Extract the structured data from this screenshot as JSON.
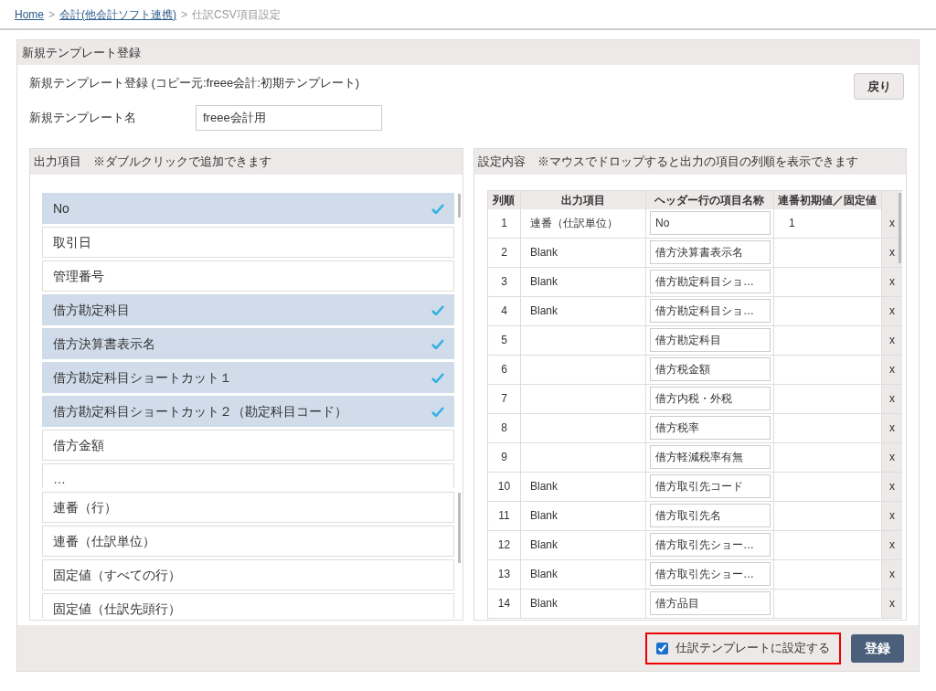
{
  "breadcrumb": [
    {
      "label": "Home",
      "kind": "link"
    },
    {
      "label": ">",
      "kind": "separator"
    },
    {
      "label": "会計(他会計ソフト連携)",
      "kind": "link"
    },
    {
      "label": ">",
      "kind": "separator"
    },
    {
      "label": "仕訳CSV項目設定",
      "kind": "current"
    }
  ],
  "panel_title": "新規テンプレート登録",
  "subtitle": "新規テンプレート登録 (コピー元:freee会計:初期テンプレート)",
  "back_button": "戻り",
  "template_name": {
    "label": "新規テンプレート名",
    "value": "freee会計用"
  },
  "output_items": {
    "title": "出力項目　※ダブルクリックで追加できます",
    "items": [
      {
        "label": "No",
        "selected": true
      },
      {
        "label": "取引日",
        "selected": false
      },
      {
        "label": "管理番号",
        "selected": false
      },
      {
        "label": "借方勘定科目",
        "selected": true
      },
      {
        "label": "借方決算書表示名",
        "selected": true
      },
      {
        "label": "借方勘定科目ショートカット１",
        "selected": true
      },
      {
        "label": "借方勘定科目ショートカット２（勘定科目コード）",
        "selected": true
      },
      {
        "label": "借方金額",
        "selected": false
      },
      {
        "label": "…",
        "selected": false
      }
    ],
    "special_items": [
      {
        "label": "連番（行）"
      },
      {
        "label": "連番（仕訳単位）"
      },
      {
        "label": "固定値（すべての行）"
      },
      {
        "label": "固定値（仕訳先頭行）"
      }
    ]
  },
  "settings": {
    "title": "設定内容　※マウスでドロップすると出力の項目の列順を表示できます",
    "columns": [
      "列順",
      "出力項目",
      "ヘッダー行の項目名称",
      "連番初期値／固定値"
    ],
    "rows": [
      {
        "order": "1",
        "item": "連番（仕訳単位）",
        "header": "No",
        "value": "1",
        "remove": "x"
      },
      {
        "order": "2",
        "item": "Blank",
        "header": "借方決算書表示名",
        "remove": "x"
      },
      {
        "order": "3",
        "item": "Blank",
        "header": "借方勘定科目ショ…",
        "remove": "x"
      },
      {
        "order": "4",
        "item": "Blank",
        "header": "借方勘定科目ショ…",
        "remove": "x"
      },
      {
        "order": "5",
        "header": "借方勘定科目",
        "remove": "x"
      },
      {
        "order": "6",
        "header": "借方税金額",
        "remove": "x"
      },
      {
        "order": "7",
        "header": "借方内税・外税",
        "remove": "x"
      },
      {
        "order": "8",
        "header": "借方税率",
        "remove": "x"
      },
      {
        "order": "9",
        "header": "借方軽減税率有無",
        "remove": "x"
      },
      {
        "order": "10",
        "item": "Blank",
        "header": "借方取引先コード",
        "remove": "x"
      },
      {
        "order": "11",
        "item": "Blank",
        "header": "借方取引先名",
        "remove": "x"
      },
      {
        "order": "12",
        "item": "Blank",
        "header": "借方取引先ショー…",
        "remove": "x"
      },
      {
        "order": "13",
        "item": "Blank",
        "header": "借方取引先ショー…",
        "remove": "x"
      },
      {
        "order": "14",
        "item": "Blank",
        "header": "借方品目",
        "remove": "x"
      }
    ]
  },
  "journal_template_checkbox": {
    "label": "仕訳テンプレートに設定する",
    "checked": true
  },
  "register_button": "登録"
}
